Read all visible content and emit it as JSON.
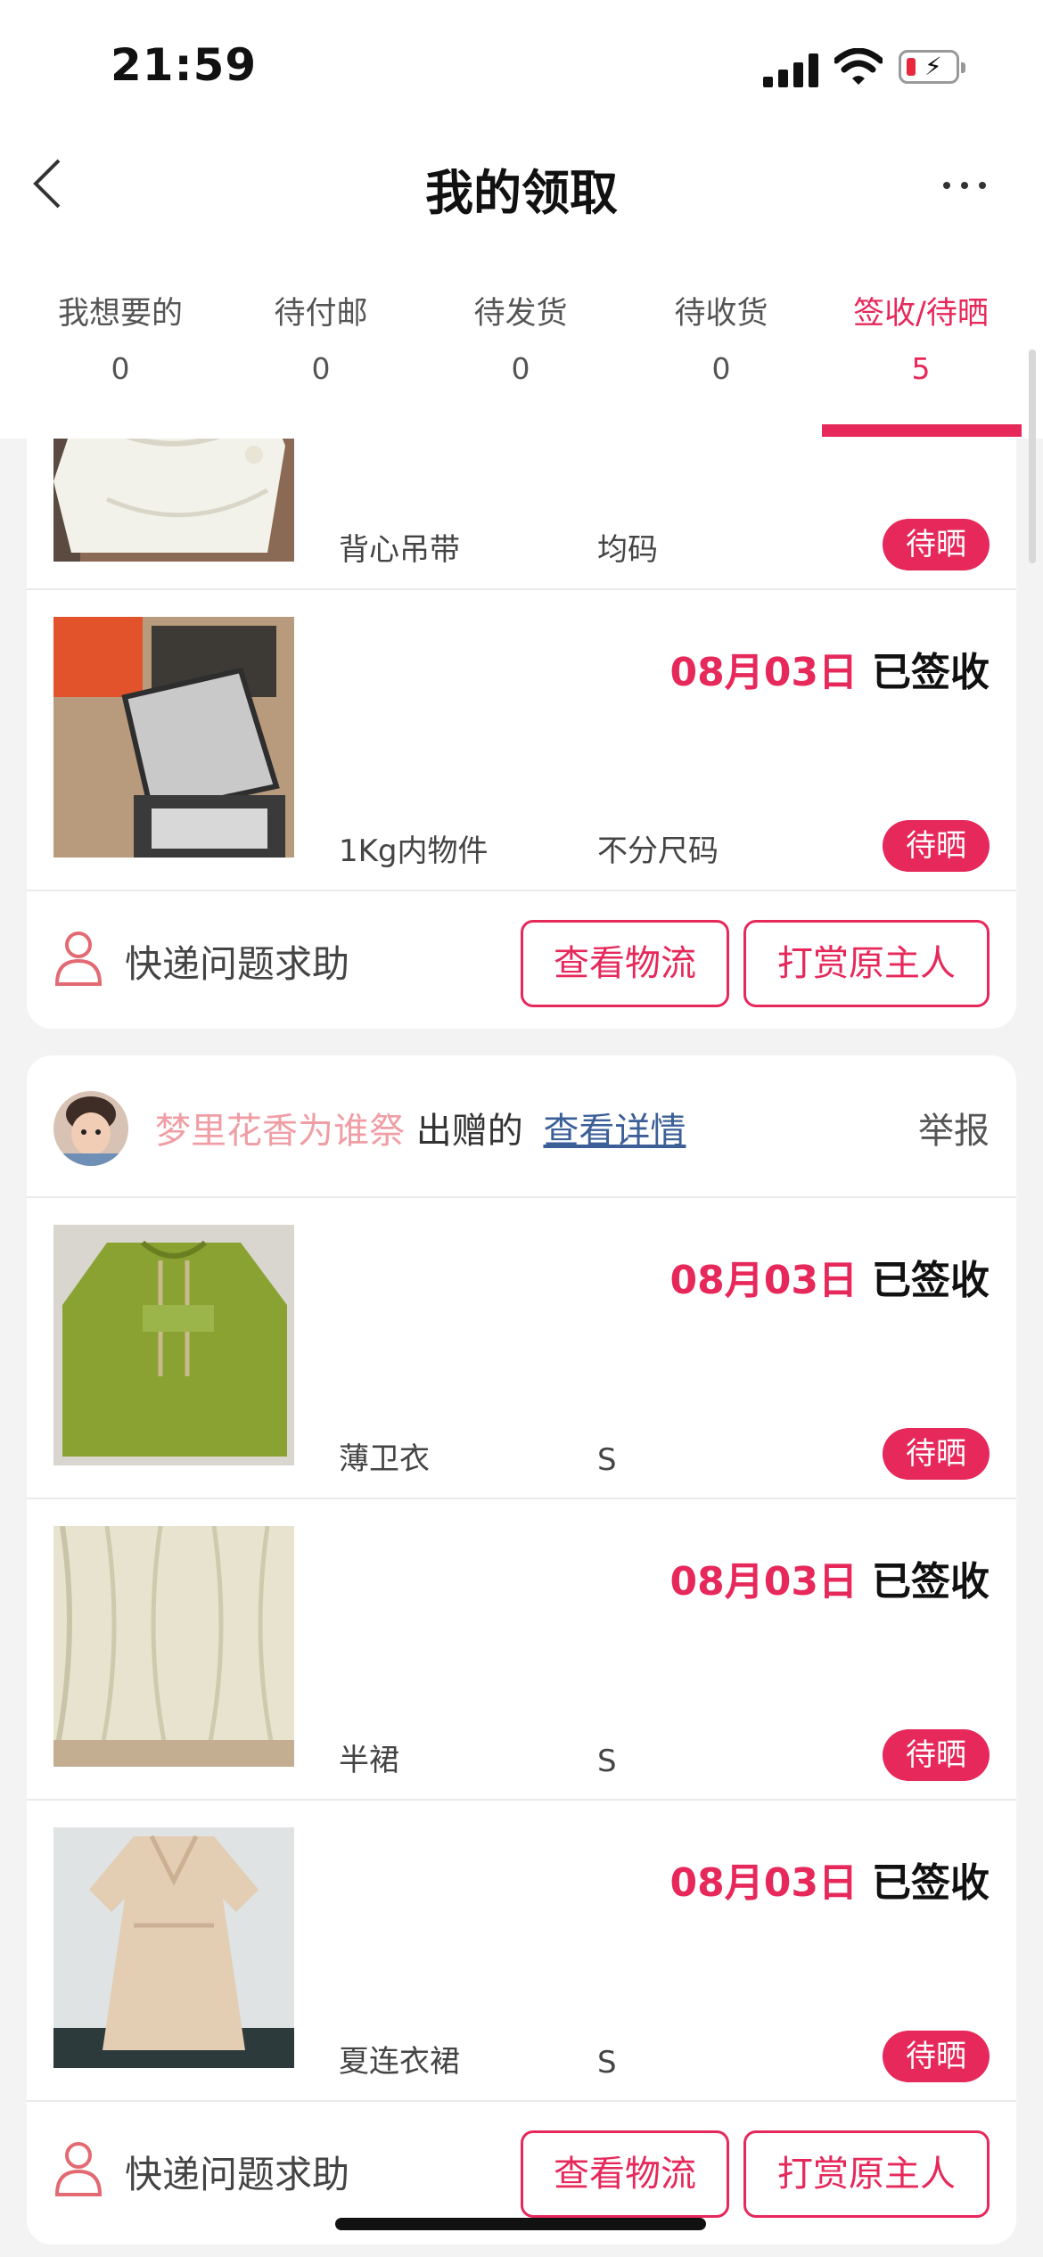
{
  "status": {
    "time": "21:59"
  },
  "header": {
    "title": "我的领取"
  },
  "tabs": [
    {
      "label": "我想要的",
      "count": "0"
    },
    {
      "label": "待付邮",
      "count": "0"
    },
    {
      "label": "待发货",
      "count": "0"
    },
    {
      "label": "待收货",
      "count": "0"
    },
    {
      "label": "签收/待晒",
      "count": "5",
      "active": true
    }
  ],
  "colors": {
    "accent": "#e6285b",
    "link": "#3c5f98",
    "giver_name": "#ef9ea5"
  },
  "order1": {
    "items": [
      {
        "name": "背心吊带",
        "size": "均码",
        "badge": "待晒"
      },
      {
        "date": "08月03日",
        "status": "已签收",
        "name": "1Kg内物件",
        "size": "不分尺码",
        "badge": "待晒"
      }
    ],
    "footer": {
      "help": "快递问题求助",
      "logistics": "查看物流",
      "reward": "打赏原主人"
    }
  },
  "order2": {
    "giver": {
      "name": "梦里花香为谁祭",
      "verb": "出赠的",
      "link": "查看详情",
      "report": "举报"
    },
    "items": [
      {
        "date": "08月03日",
        "status": "已签收",
        "name": "薄卫衣",
        "size": "S",
        "badge": "待晒"
      },
      {
        "date": "08月03日",
        "status": "已签收",
        "name": "半裙",
        "size": "S",
        "badge": "待晒"
      },
      {
        "date": "08月03日",
        "status": "已签收",
        "name": "夏连衣裙",
        "size": "S",
        "badge": "待晒"
      }
    ],
    "footer": {
      "help": "快递问题求助",
      "logistics": "查看物流",
      "reward": "打赏原主人"
    }
  }
}
